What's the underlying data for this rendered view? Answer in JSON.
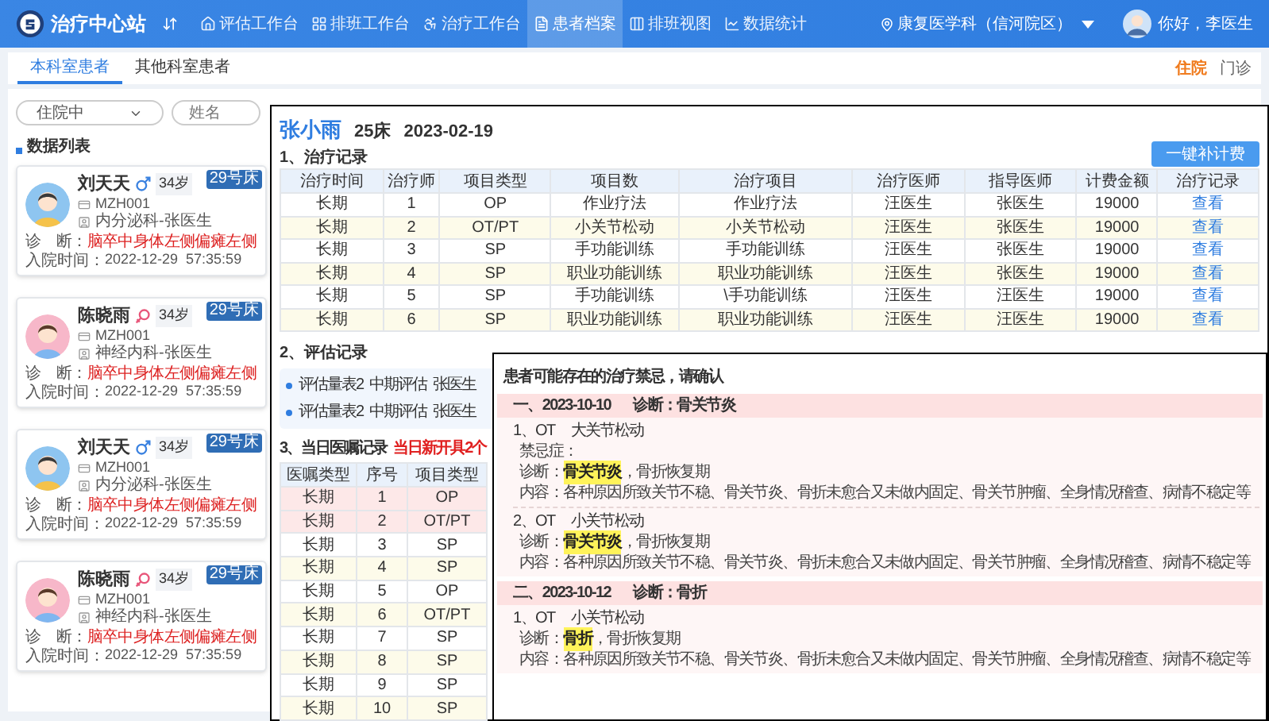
{
  "header": {
    "title": "治疗中心站",
    "nav": [
      {
        "label": "评估工作台",
        "selected": false
      },
      {
        "label": "排班工作台",
        "selected": false
      },
      {
        "label": "治疗工作台",
        "selected": false
      },
      {
        "label": "患者档案",
        "selected": true
      },
      {
        "label": "排班视图",
        "selected": false
      },
      {
        "label": "数据统计",
        "selected": false
      }
    ],
    "location": "康复医学科（信河院区）",
    "greeting": "你好，李医生"
  },
  "subtabs": [
    {
      "label": "本科室患者",
      "selected": true
    },
    {
      "label": "其他科室患者",
      "selected": false
    }
  ],
  "visit_types": [
    {
      "label": "住院",
      "selected": true
    },
    {
      "label": "门诊",
      "selected": false
    }
  ],
  "filters": {
    "status": "住院中",
    "name_placeholder": "姓名"
  },
  "list_title": "数据列表",
  "patients": [
    {
      "name": "刘天天",
      "kind": "male",
      "age": "34岁",
      "id": "MZH001",
      "department": "内分泌科-张医生",
      "diagnosis_label": "诊　断：",
      "diagnosis": "脑卒中身体左侧偏瘫左侧",
      "admission_label": "入院时间：",
      "admission": "2022-12-29  57:35:59",
      "bed": "29号床"
    },
    {
      "name": "陈晓雨",
      "kind": "female",
      "age": "34岁",
      "id": "MZH001",
      "department": "神经内科-张医生",
      "diagnosis_label": "诊　断：",
      "diagnosis": "脑卒中身体左侧偏瘫左侧",
      "admission_label": "入院时间：",
      "admission": "2022-12-29  57:35:59",
      "bed": "29号床"
    },
    {
      "name": "刘天天",
      "kind": "male",
      "age": "34岁",
      "id": "MZH001",
      "department": "内分泌科-张医生",
      "diagnosis_label": "诊　断：",
      "diagnosis": "脑卒中身体左侧偏瘫左侧",
      "admission_label": "入院时间：",
      "admission": "2022-12-29  57:35:59",
      "bed": "29号床"
    },
    {
      "name": "陈晓雨",
      "kind": "female",
      "age": "34岁",
      "id": "MZH001",
      "department": "神经内科-张医生",
      "diagnosis_label": "诊　断：",
      "diagnosis": "脑卒中身体左侧偏瘫左侧",
      "admission_label": "入院时间：",
      "admission": "2022-12-29  57:35:59",
      "bed": "29号床"
    }
  ],
  "record": {
    "patient_name": "张小雨",
    "bed": "25床",
    "date": "2023-02-19",
    "treatment": {
      "title": "1、治疗记录",
      "button": "一键补计费",
      "columns": [
        "治疗时间",
        "治疗师",
        "项目类型",
        "项目数",
        "治疗项目",
        "治疗医师",
        "指导医师",
        "计费金额",
        "治疗记录"
      ],
      "rows": [
        [
          "长期",
          "1",
          "OP",
          "作业疗法",
          "作业疗法",
          "汪医生",
          "张医生",
          "19000",
          "查看"
        ],
        [
          "长期",
          "2",
          "OT/PT",
          "小关节松动",
          "小关节松动",
          "汪医生",
          "张医生",
          "19000",
          "查看"
        ],
        [
          "长期",
          "3",
          "SP",
          "手功能训练",
          "手功能训练",
          "汪医生",
          "张医生",
          "19000",
          "查看"
        ],
        [
          "长期",
          "4",
          "SP",
          "职业功能训练",
          "职业功能训练",
          "汪医生",
          "张医生",
          "19000",
          "查看"
        ],
        [
          "长期",
          "5",
          "SP",
          "手功能训练",
          "\\手功能训练",
          "汪医生",
          "汪医生",
          "19000",
          "查看"
        ],
        [
          "长期",
          "6",
          "SP",
          "职业功能训练",
          "职业功能训练",
          "汪医生",
          "汪医生",
          "19000",
          "查看"
        ]
      ]
    },
    "assessment": {
      "title": "2、评估记录",
      "rows": [
        [
          "评估量表2",
          "中期评估",
          "张医生"
        ],
        [
          "评估量表2",
          "中期评估",
          "张医生"
        ]
      ]
    },
    "orders": {
      "title": "3、当日医嘱记录",
      "note": "当日新开具2个",
      "columns": [
        "医嘱类型",
        "序号",
        "项目类型"
      ],
      "rows": [
        {
          "cells": [
            "长期",
            "1",
            "OP"
          ],
          "new": true
        },
        {
          "cells": [
            "长期",
            "2",
            "OT/PT"
          ],
          "new": true
        },
        {
          "cells": [
            "长期",
            "3",
            "SP"
          ],
          "new": false
        },
        {
          "cells": [
            "长期",
            "4",
            "SP"
          ],
          "new": false
        },
        {
          "cells": [
            "长期",
            "5",
            "OP"
          ],
          "new": false
        },
        {
          "cells": [
            "长期",
            "6",
            "OT/PT"
          ],
          "new": false
        },
        {
          "cells": [
            "长期",
            "7",
            "SP"
          ],
          "new": false
        },
        {
          "cells": [
            "长期",
            "8",
            "SP"
          ],
          "new": false
        },
        {
          "cells": [
            "长期",
            "9",
            "SP"
          ],
          "new": false
        },
        {
          "cells": [
            "长期",
            "10",
            "SP"
          ],
          "new": false
        }
      ]
    }
  },
  "contraindications": {
    "title": "患者可能存在的治疗禁忌，请确认",
    "groups": [
      {
        "heading": "一、2023-10-10",
        "diagnosis": "诊断：骨关节炎",
        "items": [
          {
            "number": "1、OT",
            "name": "大关节松动",
            "lines": [
              {
                "label": "禁忌症："
              },
              {
                "label": "诊断：",
                "highlight": "骨关节炎",
                "text": "，骨折恢复期"
              },
              {
                "label": "内容：",
                "text": "各种原因所致关节不稳、骨关节炎、骨折未愈合又未做内固定、骨关节肿瘤、全身情况稽查、病情不稳定等"
              }
            ]
          },
          {
            "number": "2、OT",
            "name": "小关节松动",
            "lines": [
              {
                "label": "诊断：",
                "highlight": "骨关节炎",
                "text": "，骨折恢复期"
              },
              {
                "label": "内容：",
                "text": "各种原因所致关节不稳、骨关节炎、骨折未愈合又未做内固定、骨关节肿瘤、全身情况稽查、病情不稳定等"
              }
            ]
          }
        ]
      },
      {
        "heading": "二、2023-10-12",
        "diagnosis": "诊断：骨折",
        "items": [
          {
            "number": "1、OT",
            "name": "小关节松动",
            "lines": [
              {
                "label": "诊断：",
                "highlight": "骨折",
                "text": "，骨折恢复期"
              },
              {
                "label": "内容：",
                "text": "各种原因所致关节不稳、骨关节炎、骨折未愈合又未做内固定、骨关节肿瘤、全身情况稽查、病情不稳定等"
              }
            ]
          }
        ]
      }
    ]
  }
}
